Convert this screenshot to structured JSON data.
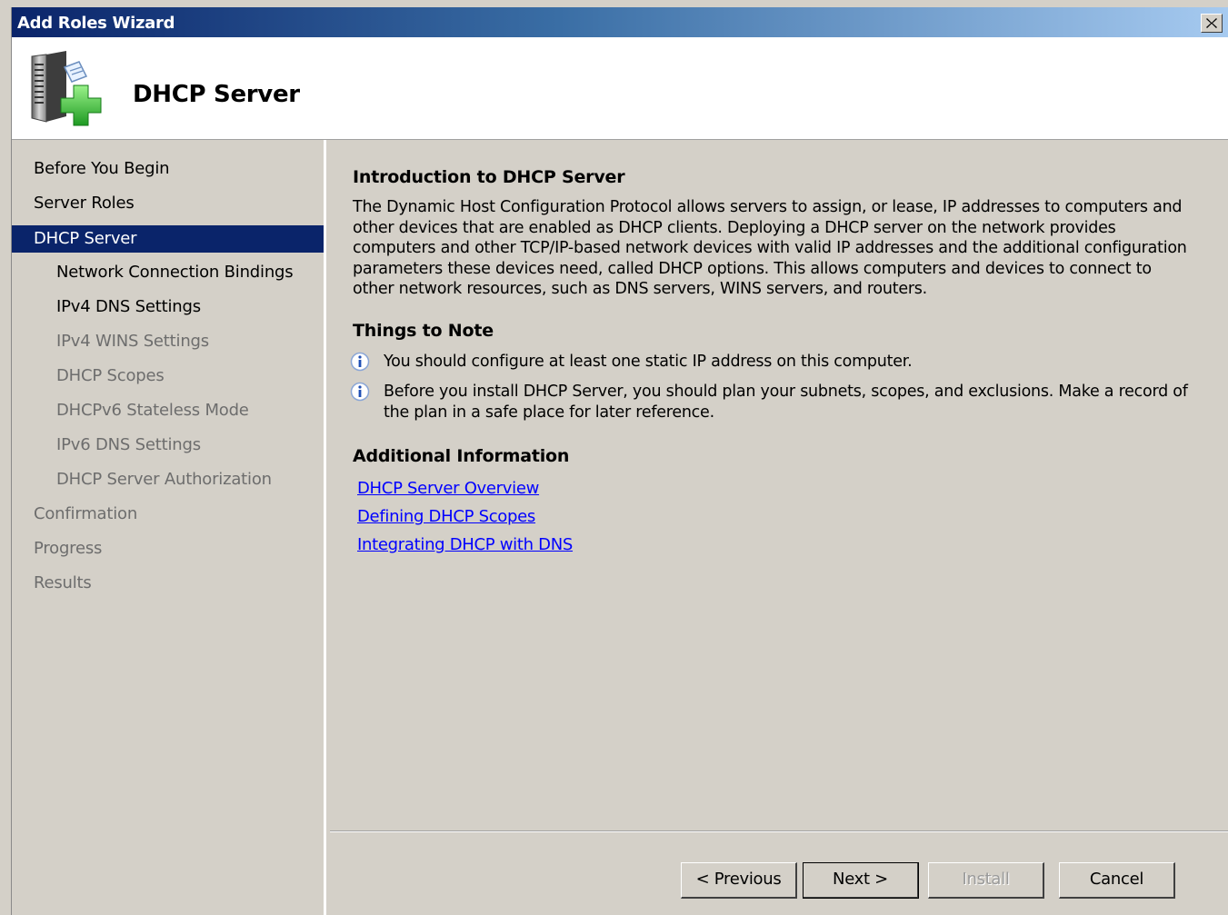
{
  "window": {
    "title": "Add Roles Wizard"
  },
  "header": {
    "title": "DHCP Server",
    "icon": "server-add-icon"
  },
  "sidebar": {
    "items": [
      {
        "label": "Before You Begin",
        "level": 0,
        "state": "normal"
      },
      {
        "label": "Server Roles",
        "level": 0,
        "state": "normal"
      },
      {
        "label": "DHCP Server",
        "level": 0,
        "state": "active"
      },
      {
        "label": "Network Connection Bindings",
        "level": 1,
        "state": "normal"
      },
      {
        "label": "IPv4 DNS Settings",
        "level": 1,
        "state": "normal"
      },
      {
        "label": "IPv4 WINS Settings",
        "level": 1,
        "state": "disabled"
      },
      {
        "label": "DHCP Scopes",
        "level": 1,
        "state": "disabled"
      },
      {
        "label": "DHCPv6 Stateless Mode",
        "level": 1,
        "state": "disabled"
      },
      {
        "label": "IPv6 DNS Settings",
        "level": 1,
        "state": "disabled"
      },
      {
        "label": "DHCP Server Authorization",
        "level": 1,
        "state": "disabled"
      },
      {
        "label": "Confirmation",
        "level": 0,
        "state": "disabled"
      },
      {
        "label": "Progress",
        "level": 0,
        "state": "disabled"
      },
      {
        "label": "Results",
        "level": 0,
        "state": "disabled"
      }
    ]
  },
  "main": {
    "intro_title": "Introduction to DHCP Server",
    "intro_text": "The Dynamic Host Configuration Protocol allows servers to assign, or lease, IP addresses to computers and other devices that are enabled as DHCP clients. Deploying a DHCP server on the network provides computers and other TCP/IP-based network devices with valid IP addresses and the additional configuration parameters these devices need, called DHCP options. This allows computers and devices to connect to other network resources, such as DNS servers, WINS servers, and routers.",
    "notes_title": "Things to Note",
    "notes": [
      "You should configure at least one static IP address on this computer.",
      "Before you install DHCP Server, you should plan your subnets, scopes, and exclusions. Make a record of the plan in a safe place for later reference."
    ],
    "additional_title": "Additional Information",
    "links": [
      "DHCP Server Overview",
      "Defining DHCP Scopes",
      "Integrating DHCP with DNS"
    ]
  },
  "footer": {
    "previous": "< Previous",
    "next": "Next >",
    "install": "Install",
    "cancel": "Cancel"
  },
  "colors": {
    "accent": "#0a246a",
    "link": "#0000ff",
    "disabled_text": "#6d6d6d",
    "window_bg": "#d4d0c8"
  }
}
